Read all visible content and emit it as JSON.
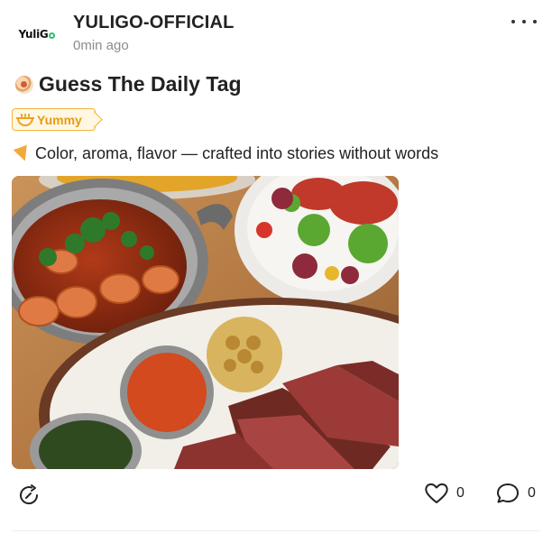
{
  "post": {
    "author": "YULIGO-OFFICIAL",
    "avatar_text": "YuliG",
    "avatar_suffix": "o",
    "time": "0min ago",
    "title": "Guess The Daily Tag",
    "title_icon": "food-emoji-icon",
    "tag": {
      "label": "Yummy",
      "icon": "bowl-icon",
      "color": "#f5b53a"
    },
    "description": "Color, aroma, flavor — crafted into stories without words",
    "description_icon": "pizza-emoji-icon",
    "image_subject": "food-photo"
  },
  "actions": {
    "share_icon": "share-icon",
    "like_icon": "heart-icon",
    "like_count": "0",
    "comment_icon": "comment-icon",
    "comment_count": "0",
    "more_icon": "more-icon"
  }
}
